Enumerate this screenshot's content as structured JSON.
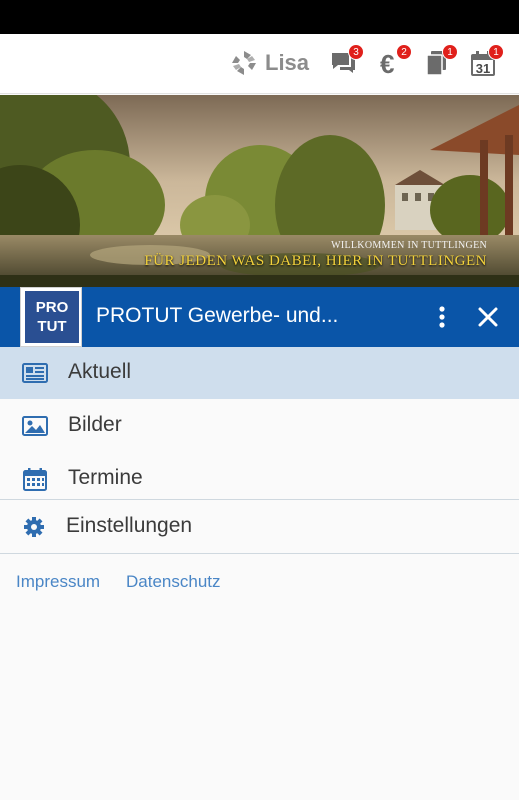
{
  "topbar": {
    "brand_name": "Lisa",
    "badges": {
      "messages": "3",
      "payments": "2",
      "documents": "1",
      "calendar": "1"
    },
    "calendar_day": "31"
  },
  "hero": {
    "welcome": "WILLKOMMEN IN TUTTLINGEN",
    "slogan": "FÜR JEDEN WAS DABEI, HIER IN TUTTLINGEN"
  },
  "drawer": {
    "logo_line1": "PRO",
    "logo_line2": "TUT",
    "title": "PROTUT Gewerbe- und..."
  },
  "nav": {
    "items": [
      {
        "label": "Aktuell",
        "icon": "newspaper-icon"
      },
      {
        "label": "Bilder",
        "icon": "image-icon"
      },
      {
        "label": "Termine",
        "icon": "calendar-icon"
      }
    ],
    "settings_label": "Einstellungen"
  },
  "footer": {
    "impressum": "Impressum",
    "datenschutz": "Datenschutz"
  },
  "colors": {
    "header_blue": "#0a55a8",
    "active_bg": "#cfdeed",
    "link_blue": "#4a86c6",
    "badge_red": "#e0201b"
  }
}
